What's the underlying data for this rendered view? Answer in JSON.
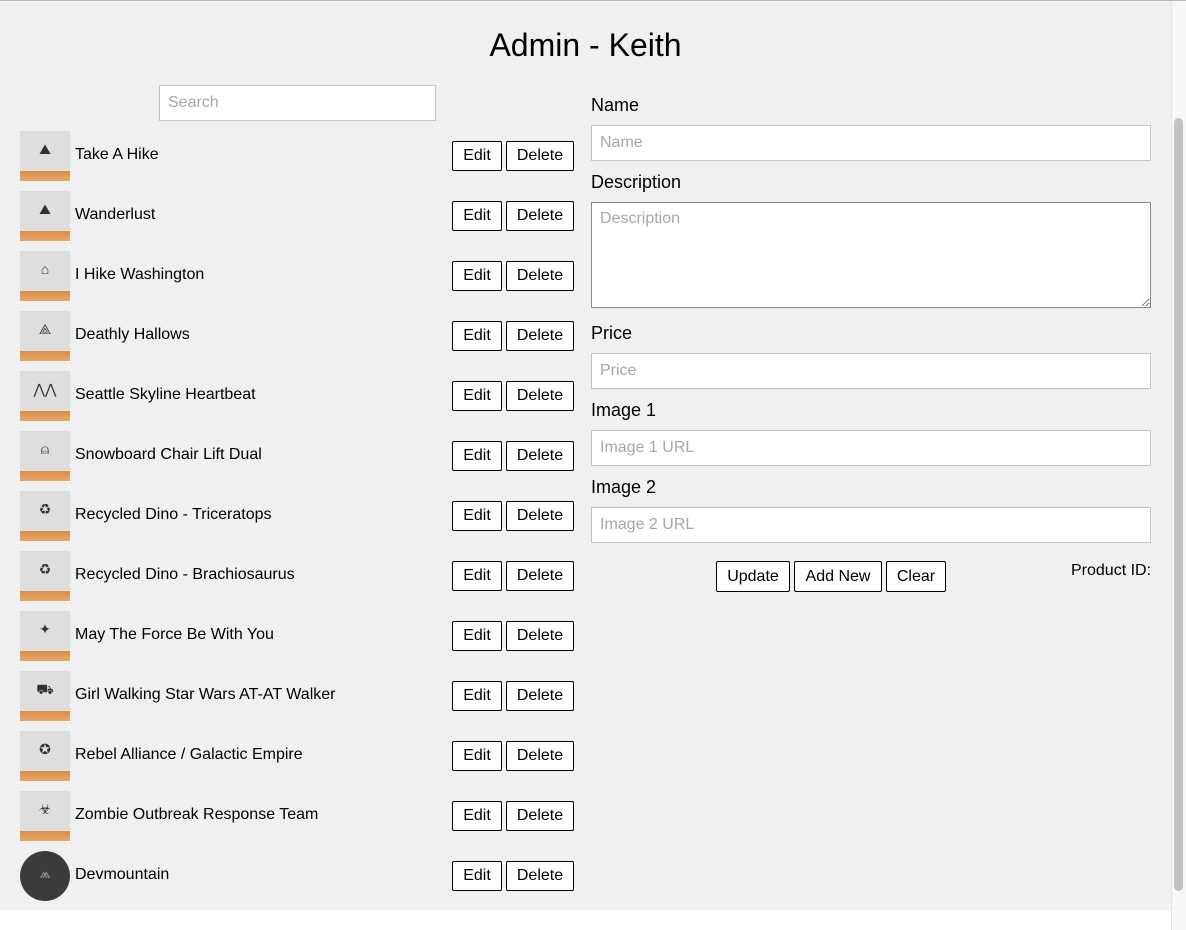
{
  "page": {
    "title": "Admin - Keith"
  },
  "search": {
    "placeholder": "Search"
  },
  "list": {
    "edit_label": "Edit",
    "delete_label": "Delete",
    "products": [
      {
        "name": "Take A Hike",
        "icon": "mountain-hike-icon",
        "glyph": "⛰"
      },
      {
        "name": "Wanderlust",
        "icon": "mountain-icon",
        "glyph": "⛰"
      },
      {
        "name": "I Hike Washington",
        "icon": "hike-icon",
        "glyph": "⌂"
      },
      {
        "name": "Deathly Hallows",
        "icon": "hallows-icon",
        "glyph": "⟁"
      },
      {
        "name": "Seattle Skyline Heartbeat",
        "icon": "skyline-icon",
        "glyph": "⋀⋀"
      },
      {
        "name": "Snowboard Chair Lift Dual",
        "icon": "chairlift-icon",
        "glyph": "⍝"
      },
      {
        "name": "Recycled Dino - Triceratops",
        "icon": "recycle-icon",
        "glyph": "♻"
      },
      {
        "name": "Recycled Dino - Brachiosaurus",
        "icon": "recycle-icon",
        "glyph": "♻"
      },
      {
        "name": "May The Force Be With You",
        "icon": "force-icon",
        "glyph": "✦"
      },
      {
        "name": "Girl Walking Star Wars AT-AT Walker",
        "icon": "atat-icon",
        "glyph": "⛟"
      },
      {
        "name": "Rebel Alliance / Galactic Empire",
        "icon": "rebel-icon",
        "glyph": "✪"
      },
      {
        "name": "Zombie Outbreak Response Team",
        "icon": "biohazard-icon",
        "glyph": "☣"
      },
      {
        "name": "Devmountain",
        "icon": "devmountain-logo-icon",
        "glyph": "⩕"
      }
    ]
  },
  "form": {
    "name_label": "Name",
    "name_placeholder": "Name",
    "description_label": "Description",
    "description_placeholder": "Description",
    "price_label": "Price",
    "price_placeholder": "Price",
    "image1_label": "Image 1",
    "image1_placeholder": "Image 1 URL",
    "image2_label": "Image 2",
    "image2_placeholder": "Image 2 URL",
    "update_label": "Update",
    "add_new_label": "Add New",
    "clear_label": "Clear",
    "product_id_label": "Product ID:"
  }
}
